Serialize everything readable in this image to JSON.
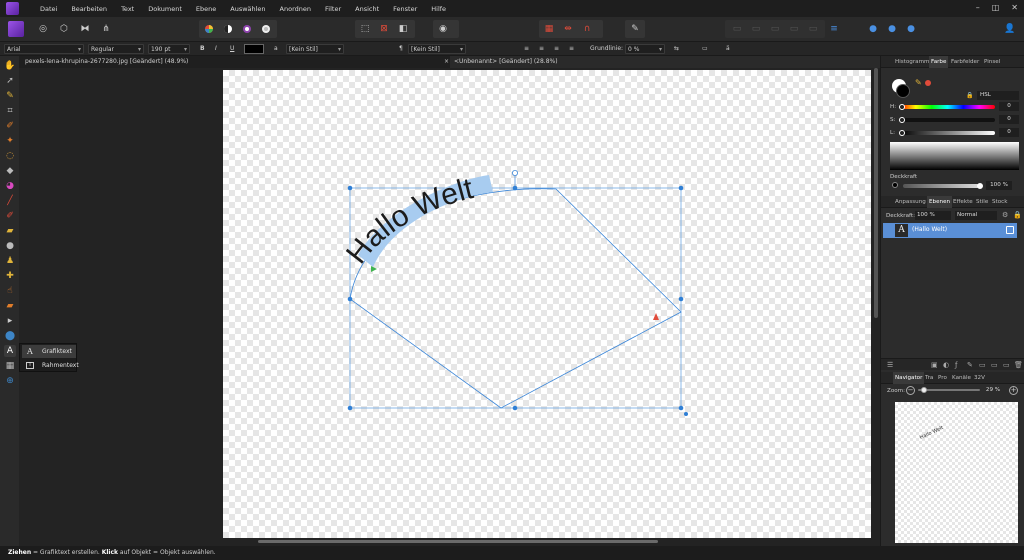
{
  "menu": [
    "Datei",
    "Bearbeiten",
    "Text",
    "Dokument",
    "Ebene",
    "Auswählen",
    "Anordnen",
    "Filter",
    "Ansicht",
    "Fenster",
    "Hilfe"
  ],
  "window_controls": [
    "–",
    "◫",
    "✕"
  ],
  "context": {
    "font": "Arial",
    "style": "Regular",
    "size": "190 pt",
    "bold": "B",
    "italic": "I",
    "underline": "U",
    "char_style": "[Kein Stil]",
    "para_style": "[Kein Stil]",
    "baseline_label": "Grundlinie:",
    "baseline_value": "0 %",
    "icon_a": "a",
    "icon_para": "¶"
  },
  "tabs": {
    "tab1": "pexels-lena-khrupina-2677280.jpg [Geändert] (48.9%)",
    "close": "×",
    "tab2": "<Unbenannt> [Geändert] (28.8%)"
  },
  "canvas": {
    "path_text": "Hallo Welt"
  },
  "flyout": {
    "item1": "Grafiktext",
    "item2": "Rahmentext",
    "icon1": "A",
    "icon2": "T"
  },
  "status": {
    "part1": "Ziehen",
    "part2": " = Grafiktext erstellen. ",
    "part3": "Klick",
    "part4": " auf Objekt = Objekt auswählen."
  },
  "color_panel": {
    "tabs": [
      "Histogramm",
      "Farbe",
      "Farbfelder",
      "Pinsel"
    ],
    "model": "HSL",
    "h": "0",
    "s": "0",
    "l": "0",
    "h_label": "H:",
    "s_label": "S:",
    "l_label": "L:",
    "opacity_label": "Deckkraft",
    "opacity_value": "100 %",
    "primary_color": "#000000",
    "secondary_color": "#ffffff"
  },
  "layers_panel": {
    "tabs": [
      "Anpassung",
      "Ebenen",
      "Effekte",
      "Stile",
      "Stock"
    ],
    "opacity_label": "Deckkraft:",
    "opacity_value": "100 %",
    "blend": "Normal",
    "layer_icon": "A",
    "layer_name": "(Hallo Welt)"
  },
  "navigator_panel": {
    "tabs": [
      "Navigator",
      "Tra",
      "Pro",
      "Kanäle",
      "32V"
    ],
    "zoom_label": "Zoom:",
    "zoom_value": "29 %",
    "minus": "−",
    "plus": "+",
    "thumb_text": "Hallo Welt"
  },
  "colors": {
    "accent": "#4a90e2",
    "selection": "#3b86d8",
    "layer_selected": "#5a8fd6"
  }
}
